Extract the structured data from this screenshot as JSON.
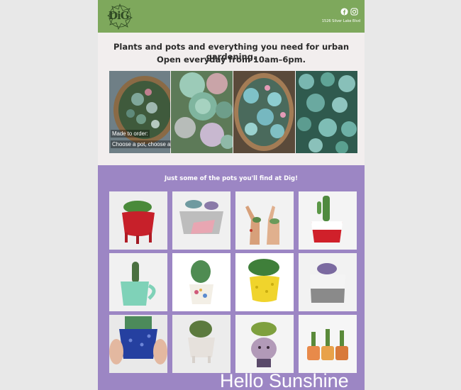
{
  "header": {
    "logo_text": "DiG",
    "address": "1526 Silver Lake Blvd",
    "social_icons": [
      "facebook-icon",
      "instagram-icon"
    ],
    "color": "#7ea85c"
  },
  "intro": {
    "line1": "Plants and pots and everything you need for urban gardening.",
    "line2": "Open everyday from 10am–6pm.",
    "caption_line1": "Made to order:",
    "caption_line2": "Choose a pot, choose a plant."
  },
  "pots_section": {
    "title": "Just some of the pots you'll find at Dig!",
    "color": "#9c86c4",
    "tiles": [
      "red-footed-pot",
      "concrete-pink-pot",
      "giraffe-planters",
      "red-white-pot",
      "mint-mug-pot",
      "floral-cup-pot",
      "yellow-dotted-pot",
      "concrete-cup-pot",
      "blue-spiky-pot",
      "white-footed-pot",
      "face-pot",
      "small-orange-pots"
    ],
    "overlay_text": "Hello Sunshine"
  }
}
